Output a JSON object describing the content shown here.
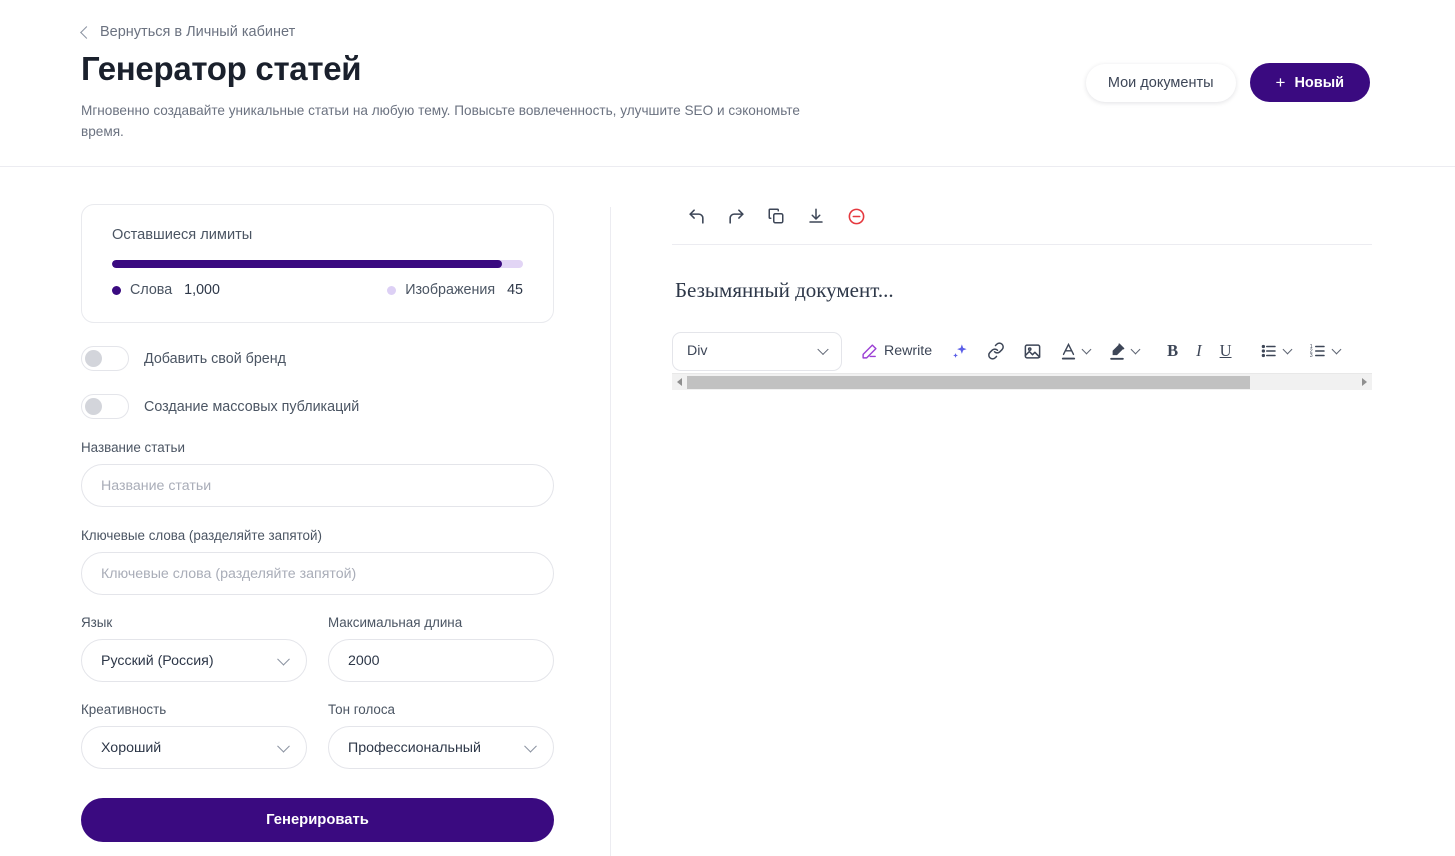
{
  "header": {
    "back_label": "Вернуться в Личный кабинет",
    "back_icon": "chevron-left-icon",
    "title": "Генератор статей",
    "subtitle": "Мгновенно создавайте уникальные статьи на любую тему. Повысьте вовлеченность, улучшите SEO и сэкономьте время.",
    "my_documents_label": "Мои документы",
    "new_label": "Новый",
    "new_icon": "plus-icon"
  },
  "limits": {
    "title": "Оставшиеся лимиты",
    "progress_percent": 95,
    "words_label": "Слова",
    "words_value": "1,000",
    "images_label": "Изображения",
    "images_value": "45"
  },
  "toggles": [
    {
      "label": "Добавить свой бренд",
      "on": false
    },
    {
      "label": "Создание массовых публикаций",
      "on": false
    }
  ],
  "form": {
    "title_label": "Название статьи",
    "title_placeholder": "Название статьи",
    "title_value": "",
    "keywords_label": "Ключевые слова (разделяйте запятой)",
    "keywords_placeholder": "Ключевые слова (разделяйте запятой)",
    "keywords_value": "",
    "language_label": "Язык",
    "language_value": "Русский (Россия)",
    "maxlength_label": "Максимальная длина",
    "maxlength_value": "2000",
    "creativity_label": "Креативность",
    "creativity_value": "Хороший",
    "tone_label": "Тон голоса",
    "tone_value": "Профессиональный",
    "generate_label": "Генерировать"
  },
  "editor": {
    "actions": [
      {
        "name": "undo-icon"
      },
      {
        "name": "redo-icon"
      },
      {
        "name": "copy-icon"
      },
      {
        "name": "download-icon"
      },
      {
        "name": "delete-icon"
      }
    ],
    "document_title": "Безымянный документ...",
    "toolbar": {
      "block_format": "Div",
      "rewrite_label": "Rewrite",
      "rewrite_icon": "pencil-icon",
      "ai_icon": "sparkle-icon",
      "link_icon": "link-icon",
      "image_icon": "image-icon",
      "text_color_icon": "text-color-icon",
      "highlight_icon": "highlighter-icon",
      "bold_label": "B",
      "italic_label": "I",
      "underline_label": "U",
      "bullet_list_icon": "bullet-list-icon",
      "numbered_list_icon": "numbered-list-icon"
    }
  },
  "colors": {
    "brand_purple": "#3a0a80",
    "progress_track": "#e2d5f5",
    "delete_red": "#e5393f",
    "rewrite_purple": "#9b3fd4",
    "sparkle_blue": "#5b5fe8"
  }
}
